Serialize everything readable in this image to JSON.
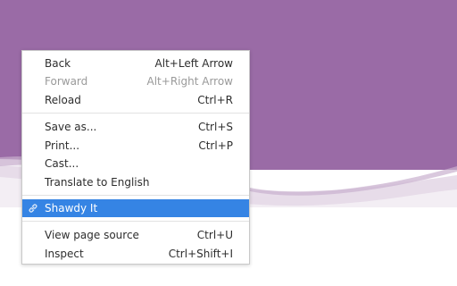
{
  "colors": {
    "wallpaper": "#9a6ba6",
    "menu_bg": "#ffffff",
    "selection": "#3584e4"
  },
  "menu": {
    "items": [
      {
        "label": "Back",
        "shortcut": "Alt+Left Arrow"
      },
      {
        "label": "Forward",
        "shortcut": "Alt+Right Arrow"
      },
      {
        "label": "Reload",
        "shortcut": "Ctrl+R"
      },
      {
        "label": "Save as...",
        "shortcut": "Ctrl+S"
      },
      {
        "label": "Print...",
        "shortcut": "Ctrl+P"
      },
      {
        "label": "Cast...",
        "shortcut": ""
      },
      {
        "label": "Translate to English",
        "shortcut": ""
      },
      {
        "label": "Shawdy It",
        "shortcut": "",
        "icon": "link-icon"
      },
      {
        "label": "View page source",
        "shortcut": "Ctrl+U"
      },
      {
        "label": "Inspect",
        "shortcut": "Ctrl+Shift+I"
      }
    ]
  }
}
